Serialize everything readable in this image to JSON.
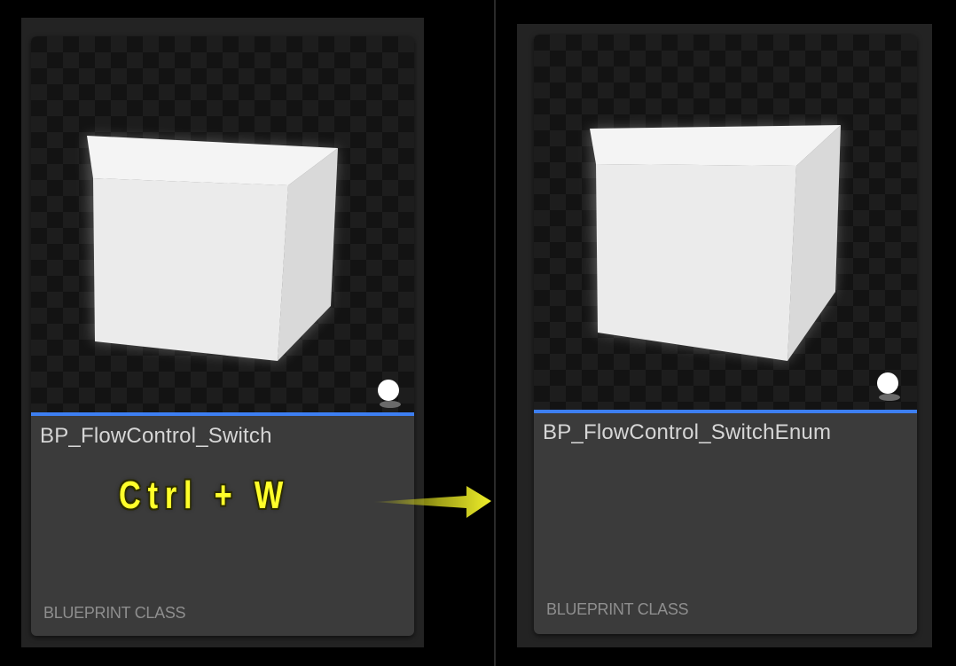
{
  "before": {
    "asset_name": "BP_FlowControl_Switch",
    "asset_type": "BLUEPRINT CLASS"
  },
  "after": {
    "asset_name": "BP_FlowControl_SwitchEnum",
    "asset_type": "BLUEPRINT CLASS"
  },
  "shortcut": {
    "label": "Ctrl + W"
  },
  "icons": {
    "thumbnail": "white-cube-icon",
    "actor_badge": "actor-sphere-icon",
    "transition": "arrow-right-icon"
  },
  "colors": {
    "accent_bar": "#3d7ff2",
    "shortcut_text": "#ffff2a",
    "arrow": "#e6e61a",
    "card_bg": "#3b3b3b",
    "background": "#000000"
  }
}
